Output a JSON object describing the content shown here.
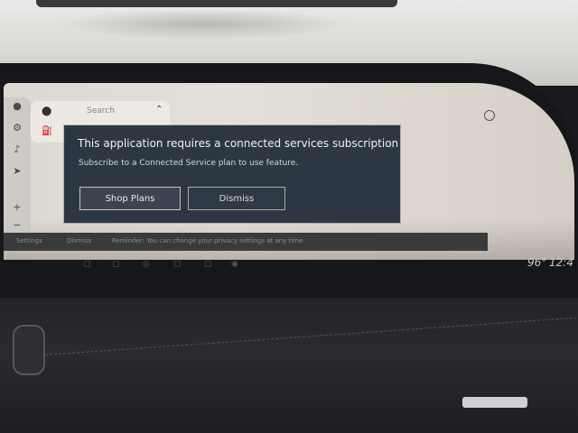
{
  "search": {
    "label": "Search"
  },
  "dialog": {
    "title": "This application requires a connected services subscription",
    "message": "Subscribe to a Connected Service plan to use feature.",
    "primary_label": "Shop Plans",
    "secondary_label": "Dismiss"
  },
  "status_bar": {
    "settings_label": "Settings",
    "dismiss_label": "Dismiss",
    "reminder_text": "Reminder: You can change your privacy settings at any time"
  },
  "readout": {
    "temperature": "96°",
    "clock": "12:4"
  },
  "rail": {
    "zoom_in": "+",
    "zoom_out": "−"
  },
  "icons": {
    "mic": "microphone-icon",
    "gear": "gear-icon",
    "volume": "volume-icon",
    "compass": "compass-icon",
    "pin": "map-pin-icon",
    "fuel": "fuel-icon",
    "chevron": "chevron-up-icon"
  }
}
